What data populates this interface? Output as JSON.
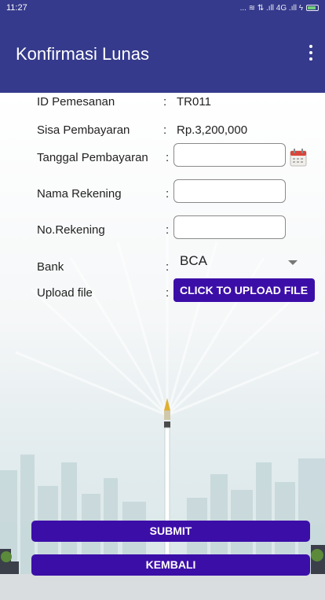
{
  "status_bar": {
    "time": "11:27",
    "indicators": "... ≋ ⇅ .ıll 4G .ıll ϟ"
  },
  "app_bar": {
    "title": "Konfirmasi Lunas"
  },
  "form": {
    "id_label": "ID Pemesanan",
    "id_value": "TR011",
    "sisa_label": "Sisa Pembayaran",
    "sisa_value": "Rp.3,200,000",
    "tanggal_label": "Tanggal Pembayaran",
    "tanggal_value": "",
    "nama_label": "Nama Rekening",
    "nama_value": "",
    "norek_label": "No.Rekening",
    "norek_value": "",
    "bank_label": "Bank",
    "bank_value": "BCA",
    "upload_label": "Upload file",
    "upload_button": "CLICK TO UPLOAD FILE",
    "colon": ":"
  },
  "actions": {
    "submit": "SUBMIT",
    "back": "KEMBALI"
  },
  "colors": {
    "primary": "#353a8c",
    "button": "#3c0ea8"
  }
}
